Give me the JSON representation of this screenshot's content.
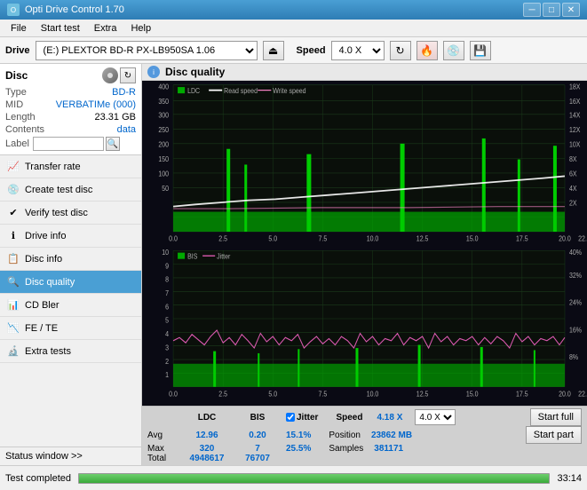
{
  "titlebar": {
    "title": "Opti Drive Control 1.70",
    "min_btn": "─",
    "max_btn": "□",
    "close_btn": "✕"
  },
  "menubar": {
    "items": [
      "File",
      "Start test",
      "Extra",
      "Help"
    ]
  },
  "toolbar": {
    "drive_label": "Drive",
    "drive_value": "(E:)  PLEXTOR BD-R   PX-LB950SA 1.06",
    "speed_label": "Speed",
    "speed_value": "4.0 X"
  },
  "disc": {
    "title": "Disc",
    "type_label": "Type",
    "type_value": "BD-R",
    "mid_label": "MID",
    "mid_value": "VERBATIMe (000)",
    "length_label": "Length",
    "length_value": "23.31 GB",
    "contents_label": "Contents",
    "contents_value": "data",
    "label_label": "Label"
  },
  "nav": {
    "items": [
      {
        "id": "transfer-rate",
        "label": "Transfer rate",
        "icon": "📈"
      },
      {
        "id": "create-test-disc",
        "label": "Create test disc",
        "icon": "💿"
      },
      {
        "id": "verify-test-disc",
        "label": "Verify test disc",
        "icon": "✅"
      },
      {
        "id": "drive-info",
        "label": "Drive info",
        "icon": "ℹ"
      },
      {
        "id": "disc-info",
        "label": "Disc info",
        "icon": "📋"
      },
      {
        "id": "disc-quality",
        "label": "Disc quality",
        "icon": "🔍",
        "active": true
      },
      {
        "id": "cd-bler",
        "label": "CD Bler",
        "icon": "📊"
      },
      {
        "id": "fe-te",
        "label": "FE / TE",
        "icon": "📉"
      },
      {
        "id": "extra-tests",
        "label": "Extra tests",
        "icon": "🔬"
      }
    ]
  },
  "chart_header": {
    "title": "Disc quality"
  },
  "legend": {
    "ldc": "LDC",
    "read_speed": "Read speed",
    "write_speed": "Write speed",
    "bis": "BIS",
    "jitter": "Jitter"
  },
  "stats": {
    "columns": [
      "",
      "LDC",
      "BIS",
      "",
      "Jitter",
      "Speed",
      ""
    ],
    "avg_label": "Avg",
    "avg_ldc": "12.96",
    "avg_bis": "0.20",
    "avg_jitter": "15.1%",
    "avg_speed": "4.18 X",
    "max_label": "Max",
    "max_ldc": "320",
    "max_bis": "7",
    "max_jitter": "25.5%",
    "position_label": "Position",
    "position_val": "23862 MB",
    "total_label": "Total",
    "total_ldc": "4948617",
    "total_bis": "76707",
    "samples_label": "Samples",
    "samples_val": "381171",
    "speed_select": "4.0 X",
    "start_full_btn": "Start full",
    "start_part_btn": "Start part",
    "jitter_checked": true
  },
  "statusbar": {
    "status_window_btn": "Status window >>",
    "progress": 100,
    "status_text": "Test completed",
    "time": "33:14"
  },
  "colors": {
    "ldc_bar": "#00cc00",
    "read_speed": "#ffffff",
    "write_speed": "#ff69b4",
    "bis_bar": "#00cc00",
    "jitter_line": "#ff69b4",
    "chart_bg": "#0a0a1a",
    "grid": "#1a3a1a",
    "accent_blue": "#0066cc"
  }
}
